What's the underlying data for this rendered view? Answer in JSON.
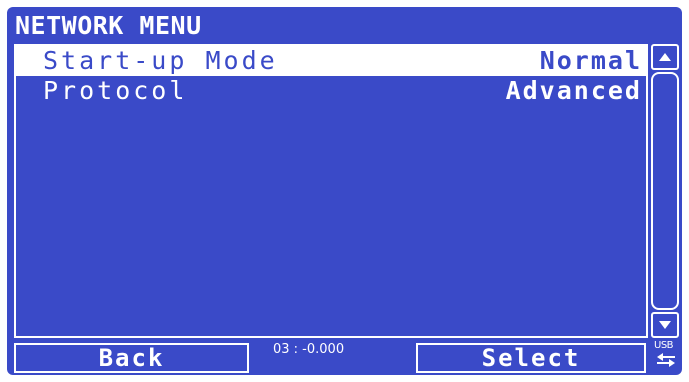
{
  "title": "NETWORK MENU",
  "menu": {
    "items": [
      {
        "label": "Start-up Mode",
        "value": "Normal",
        "selected": true
      },
      {
        "label": "Protocol",
        "value": "Advanced",
        "selected": false
      }
    ]
  },
  "softkeys": {
    "left_label": "Back",
    "right_label": "Select"
  },
  "status": {
    "text": "03 : -0.000",
    "usb_label": "USB"
  },
  "colors": {
    "background": "#3a4ac8",
    "foreground": "#ffffff"
  },
  "icons": {
    "scroll_up": "triangle-up-icon",
    "scroll_down": "triangle-down-icon",
    "usb": "usb-arrows-icon"
  }
}
